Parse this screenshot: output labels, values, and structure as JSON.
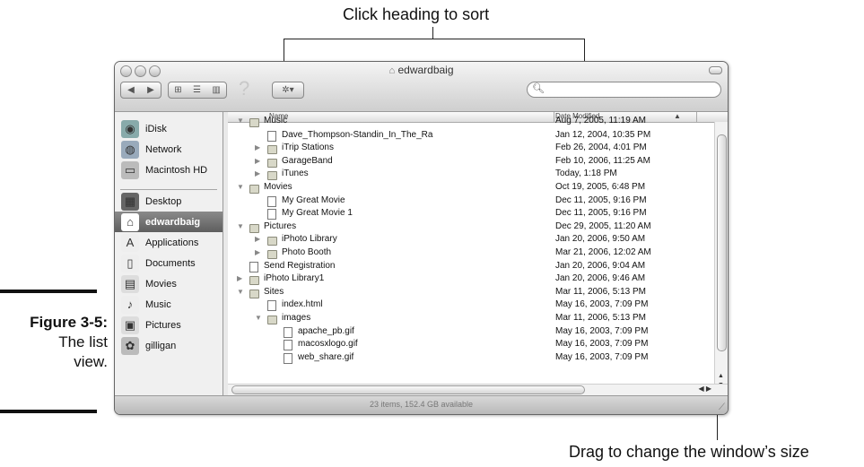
{
  "annotations": {
    "top": "Click heading to sort",
    "bottom": "Drag to change the window’s size"
  },
  "figure": {
    "number": "Figure 3-5:",
    "caption_line1": "The list",
    "caption_line2": "view."
  },
  "window": {
    "title": "edwardbaig",
    "search_placeholder": "",
    "status": "23 items, 152.4 GB available"
  },
  "sidebar": {
    "items": [
      {
        "label": "iDisk",
        "icon": "idisk-icon"
      },
      {
        "label": "Network",
        "icon": "network-icon"
      },
      {
        "label": "Macintosh HD",
        "icon": "hard-drive-icon"
      },
      {
        "label": "Desktop",
        "icon": "desktop-icon"
      },
      {
        "label": "edwardbaig",
        "icon": "home-icon",
        "selected": true
      },
      {
        "label": "Applications",
        "icon": "applications-icon"
      },
      {
        "label": "Documents",
        "icon": "documents-icon"
      },
      {
        "label": "Movies",
        "icon": "movies-icon"
      },
      {
        "label": "Music",
        "icon": "music-icon"
      },
      {
        "label": "Pictures",
        "icon": "pictures-icon"
      },
      {
        "label": "gilligan",
        "icon": "gilligan-icon"
      }
    ]
  },
  "columns": {
    "name": "Name",
    "date": "Date Modified"
  },
  "rows": [
    {
      "name": "Music",
      "date": "Aug 7, 2005, 11:19 AM",
      "level": 0,
      "disclosure": "open",
      "kind": "folder"
    },
    {
      "name": "Dave_Thompson-Standin_In_The_Ra",
      "date": "Jan 12, 2004, 10:35 PM",
      "level": 1,
      "disclosure": "none",
      "kind": "doc"
    },
    {
      "name": "iTrip Stations",
      "date": "Feb 26, 2004, 4:01 PM",
      "level": 1,
      "disclosure": "closed",
      "kind": "folder"
    },
    {
      "name": "GarageBand",
      "date": "Feb 10, 2006, 11:25 AM",
      "level": 1,
      "disclosure": "closed",
      "kind": "folder"
    },
    {
      "name": "iTunes",
      "date": "Today, 1:18 PM",
      "level": 1,
      "disclosure": "closed",
      "kind": "folder"
    },
    {
      "name": "Movies",
      "date": "Oct 19, 2005, 6:48 PM",
      "level": 0,
      "disclosure": "open",
      "kind": "folder"
    },
    {
      "name": "My Great Movie",
      "date": "Dec 11, 2005, 9:16 PM",
      "level": 1,
      "disclosure": "none",
      "kind": "doc"
    },
    {
      "name": "My Great Movie 1",
      "date": "Dec 11, 2005, 9:16 PM",
      "level": 1,
      "disclosure": "none",
      "kind": "doc"
    },
    {
      "name": "Pictures",
      "date": "Dec 29, 2005, 11:20 AM",
      "level": 0,
      "disclosure": "open",
      "kind": "folder"
    },
    {
      "name": "iPhoto Library",
      "date": "Jan 20, 2006, 9:50 AM",
      "level": 1,
      "disclosure": "closed",
      "kind": "folder"
    },
    {
      "name": "Photo Booth",
      "date": "Mar 21, 2006, 12:02 AM",
      "level": 1,
      "disclosure": "closed",
      "kind": "folder"
    },
    {
      "name": "Send Registration",
      "date": "Jan 20, 2006, 9:04 AM",
      "level": 0,
      "disclosure": "none",
      "kind": "doc"
    },
    {
      "name": "iPhoto Library1",
      "date": "Jan 20, 2006, 9:46 AM",
      "level": 0,
      "disclosure": "closed",
      "kind": "folder"
    },
    {
      "name": "Sites",
      "date": "Mar 11, 2006, 5:13 PM",
      "level": 0,
      "disclosure": "open",
      "kind": "folder"
    },
    {
      "name": "index.html",
      "date": "May 16, 2003, 7:09 PM",
      "level": 1,
      "disclosure": "none",
      "kind": "doc"
    },
    {
      "name": "images",
      "date": "Mar 11, 2006, 5:13 PM",
      "level": 1,
      "disclosure": "open",
      "kind": "folder"
    },
    {
      "name": "apache_pb.gif",
      "date": "May 16, 2003, 7:09 PM",
      "level": 2,
      "disclosure": "none",
      "kind": "doc"
    },
    {
      "name": "macosxlogo.gif",
      "date": "May 16, 2003, 7:09 PM",
      "level": 2,
      "disclosure": "none",
      "kind": "doc"
    },
    {
      "name": "web_share.gif",
      "date": "May 16, 2003, 7:09 PM",
      "level": 2,
      "disclosure": "none",
      "kind": "doc"
    }
  ]
}
